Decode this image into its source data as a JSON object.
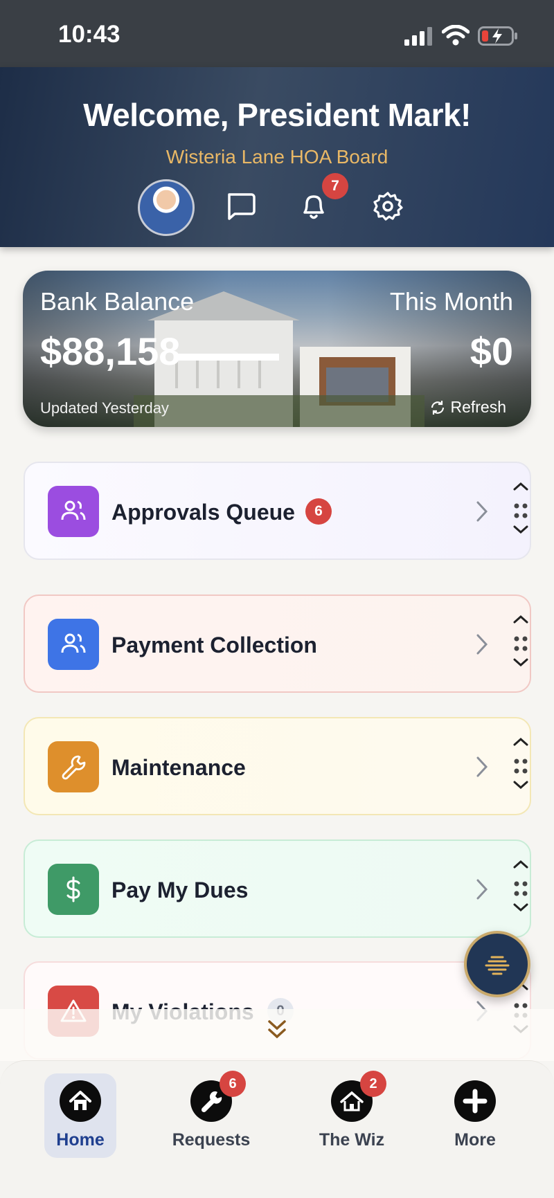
{
  "status_bar": {
    "time": "10:43"
  },
  "header": {
    "welcome": "Welcome, President Mark!",
    "org": "Wisteria Lane HOA Board",
    "notification_count": "7"
  },
  "balance": {
    "bank_label": "Bank Balance",
    "bank_amount": "$88,158",
    "month_label": "This Month",
    "month_amount": "$0",
    "updated": "Updated Yesterday",
    "refresh_label": "Refresh"
  },
  "cards": [
    {
      "label": "Approvals Queue",
      "badge": "6",
      "icon": "users-icon",
      "color": "#9b4de0"
    },
    {
      "label": "Payment Collection",
      "icon": "users-icon",
      "color": "#3e74e6"
    },
    {
      "label": "Maintenance",
      "icon": "wrench-icon",
      "color": "#de8f2c"
    },
    {
      "label": "Pay My Dues",
      "icon": "dollar-icon",
      "color": "#3f9a67"
    },
    {
      "label": "My Violations",
      "badge": "0",
      "icon": "warning-icon",
      "color": "#d84a45"
    }
  ],
  "tabs": [
    {
      "label": "Home",
      "icon": "home-icon",
      "active": true
    },
    {
      "label": "Requests",
      "icon": "wrench-icon",
      "badge": "6"
    },
    {
      "label": "The Wiz",
      "icon": "house-wizard-icon",
      "badge": "2"
    },
    {
      "label": "More",
      "icon": "plus-icon"
    }
  ]
}
